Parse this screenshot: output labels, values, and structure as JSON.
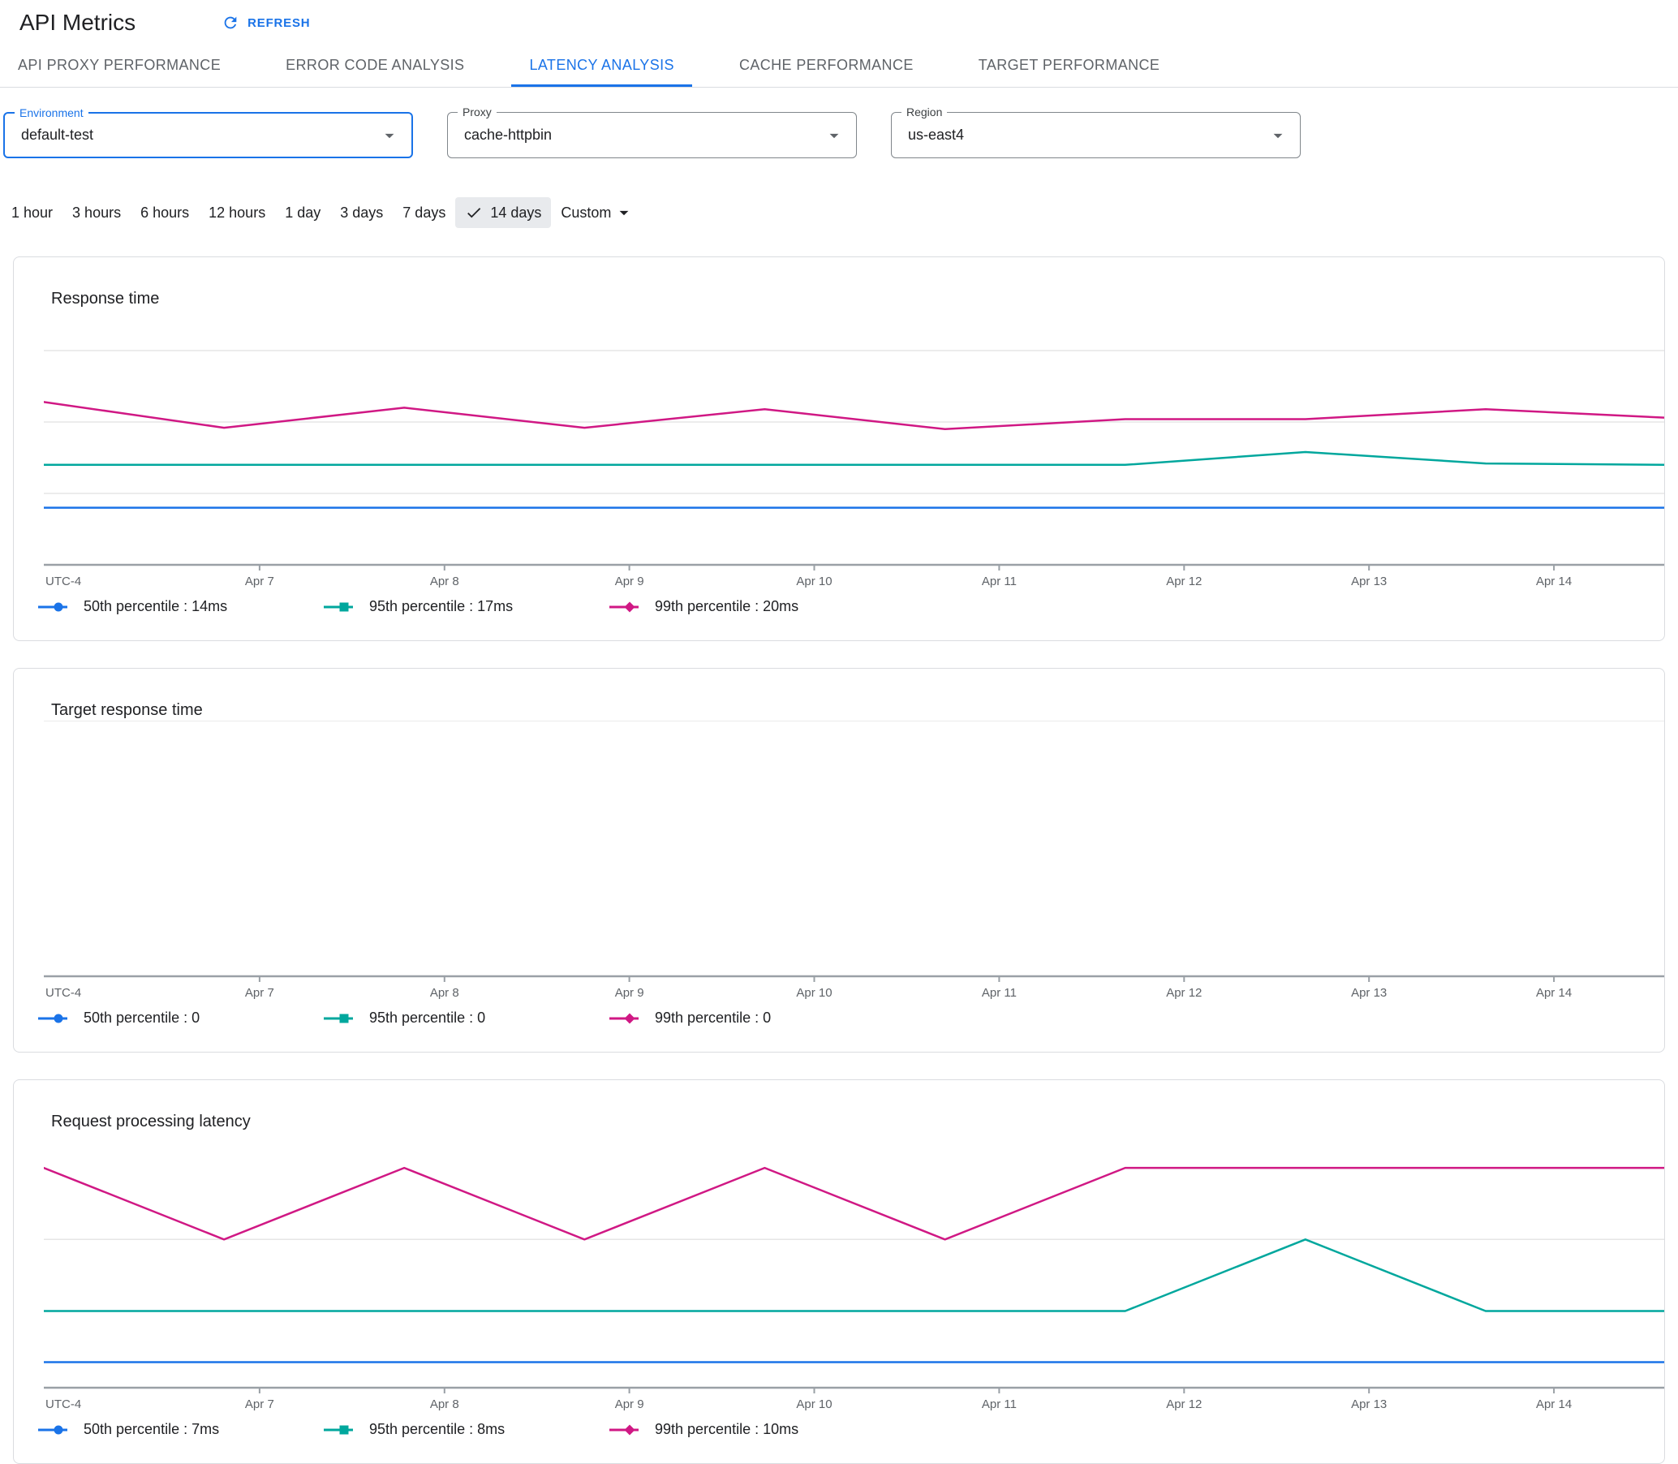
{
  "header": {
    "title": "API Metrics",
    "refresh_label": "REFRESH"
  },
  "tabs": [
    {
      "label": "API PROXY PERFORMANCE",
      "active": false
    },
    {
      "label": "ERROR CODE ANALYSIS",
      "active": false
    },
    {
      "label": "LATENCY ANALYSIS",
      "active": true
    },
    {
      "label": "CACHE PERFORMANCE",
      "active": false
    },
    {
      "label": "TARGET PERFORMANCE",
      "active": false
    }
  ],
  "filters": [
    {
      "id": "environment",
      "label": "Environment",
      "value": "default-test",
      "focused": true
    },
    {
      "id": "proxy",
      "label": "Proxy",
      "value": "cache-httpbin",
      "focused": false
    },
    {
      "id": "region",
      "label": "Region",
      "value": "us-east4",
      "focused": false
    }
  ],
  "time_range": {
    "options": [
      "1 hour",
      "3 hours",
      "6 hours",
      "12 hours",
      "1 day",
      "3 days",
      "7 days",
      "14 days"
    ],
    "selected": "14 days",
    "custom_label": "Custom"
  },
  "colors": {
    "p50": "#1a73e8",
    "p95": "#00a79d",
    "p99": "#d01884",
    "axis": "#9aa0a6",
    "grid": "#e6e6e6"
  },
  "chart_data": [
    {
      "type": "line",
      "title": "Response time",
      "x_axis_label": "UTC-4",
      "x_tick_labels": [
        "Apr 7",
        "Apr 8",
        "Apr 9",
        "Apr 10",
        "Apr 11",
        "Apr 12",
        "Apr 13",
        "Apr 14"
      ],
      "ylim": [
        10,
        27.9
      ],
      "gridlines": [
        15,
        20,
        25
      ],
      "legend_position": "bottom",
      "series": [
        {
          "name": "50th percentile",
          "value_label": "14ms",
          "color_key": "p50",
          "marker": "circle",
          "values": [
            14,
            14,
            14,
            14,
            14,
            14,
            14,
            14,
            14,
            14
          ]
        },
        {
          "name": "95th percentile",
          "value_label": "17ms",
          "color_key": "p95",
          "marker": "square",
          "values": [
            17,
            17,
            17,
            17,
            17,
            17,
            17,
            17.9,
            17.1,
            17
          ]
        },
        {
          "name": "99th percentile",
          "value_label": "20ms",
          "color_key": "p99",
          "marker": "diamond",
          "values": [
            21.4,
            19.6,
            21,
            19.6,
            20.9,
            19.5,
            20.2,
            20.2,
            20.9,
            20.3
          ]
        }
      ]
    },
    {
      "type": "line",
      "title": "Target response time",
      "x_axis_label": "UTC-4",
      "x_tick_labels": [
        "Apr 7",
        "Apr 8",
        "Apr 9",
        "Apr 10",
        "Apr 11",
        "Apr 12",
        "Apr 13",
        "Apr 14"
      ],
      "ylim": [
        0,
        1
      ],
      "gridlines": [
        1
      ],
      "legend_position": "bottom",
      "series": [
        {
          "name": "50th percentile",
          "value_label": "0",
          "color_key": "p50",
          "marker": "circle",
          "values": null
        },
        {
          "name": "95th percentile",
          "value_label": "0",
          "color_key": "p95",
          "marker": "square",
          "values": null
        },
        {
          "name": "99th percentile",
          "value_label": "0",
          "color_key": "p99",
          "marker": "diamond",
          "values": null
        }
      ]
    },
    {
      "type": "line",
      "title": "Request processing latency",
      "x_axis_label": "UTC-4",
      "x_tick_labels": [
        "Apr 7",
        "Apr 8",
        "Apr 9",
        "Apr 10",
        "Apr 11",
        "Apr 12",
        "Apr 13",
        "Apr 14"
      ],
      "ylim": [
        6.5,
        11.5
      ],
      "gridlines": [
        9.4
      ],
      "legend_position": "bottom",
      "series": [
        {
          "name": "50th percentile",
          "value_label": "7ms",
          "color_key": "p50",
          "marker": "circle",
          "values": [
            7,
            7,
            7,
            7,
            7,
            7,
            7,
            7,
            7,
            7
          ]
        },
        {
          "name": "95th percentile",
          "value_label": "8ms",
          "color_key": "p95",
          "marker": "square",
          "values": [
            8,
            8,
            8,
            8,
            8,
            8,
            8,
            9.4,
            8,
            8
          ]
        },
        {
          "name": "99th percentile",
          "value_label": "10ms",
          "color_key": "p99",
          "marker": "diamond",
          "values": [
            10.8,
            9.4,
            10.8,
            9.4,
            10.8,
            9.4,
            10.8,
            10.8,
            10.8,
            10.8
          ]
        }
      ]
    }
  ]
}
